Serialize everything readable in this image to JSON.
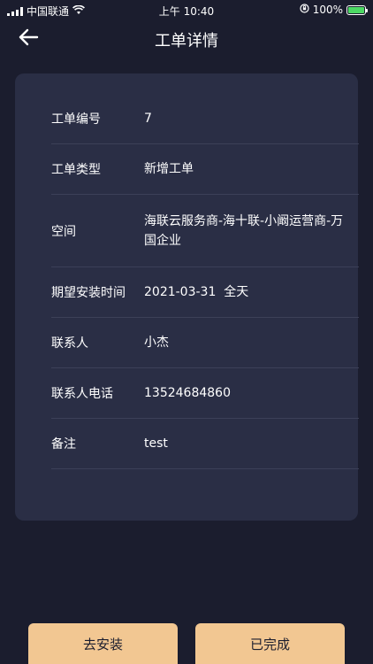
{
  "status_bar": {
    "carrier": "中国联通",
    "time": "上午 10:40",
    "battery": "100%",
    "battery_level": 1.0
  },
  "nav": {
    "title": "工单详情",
    "back_icon": "arrow-left-icon"
  },
  "details": [
    {
      "label": "工单编号",
      "value": "7"
    },
    {
      "label": "工单类型",
      "value": "新增工单"
    },
    {
      "label": "空间",
      "value": "海联云服务商-海十联-小阚运营商-万国企业"
    },
    {
      "label": "期望安装时间",
      "value": "2021-03-31  全天"
    },
    {
      "label": "联系人",
      "value": "小杰"
    },
    {
      "label": "联系人电话",
      "value": "13524684860"
    },
    {
      "label": "备注",
      "value": "test"
    }
  ],
  "actions": {
    "install_label": "去安装",
    "completed_label": "已完成"
  },
  "colors": {
    "background": "#1b1d2e",
    "card": "#2a2e45",
    "divider": "#3c4058",
    "button": "#f2c792",
    "battery": "#4cd964"
  }
}
